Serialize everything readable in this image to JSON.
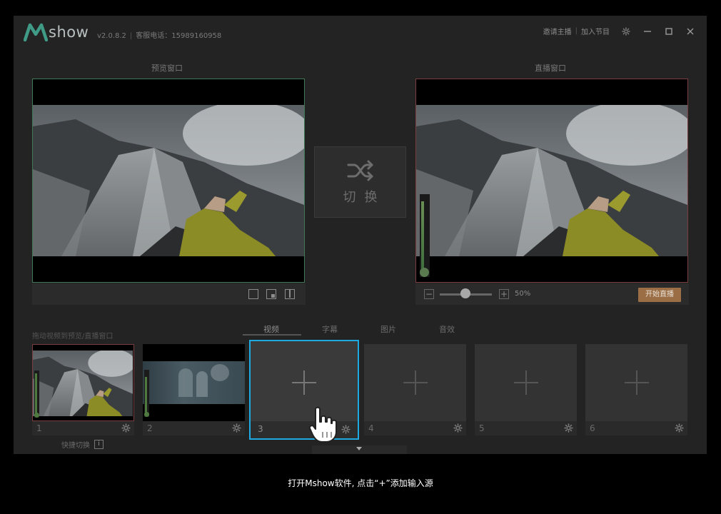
{
  "app": {
    "logo_text": "show",
    "version": "v2.0.8.2",
    "hotline": "客服电话：15989160958",
    "invite_host": "邀请主播",
    "join_program": "加入节目"
  },
  "panels": {
    "preview_title": "预览窗口",
    "live_title": "直播窗口",
    "switch_label": "切换",
    "volume_pct": "50%",
    "go_live": "开始直播"
  },
  "sources": {
    "drag_hint": "拖动视频到预览/直播窗口",
    "tabs": [
      "视频",
      "字幕",
      "图片",
      "音效"
    ],
    "active_tab": 0,
    "items": [
      {
        "num": "1",
        "content": "waterfall"
      },
      {
        "num": "2",
        "content": "concert"
      },
      {
        "num": "3",
        "content": "add"
      },
      {
        "num": "4",
        "content": "add"
      },
      {
        "num": "5",
        "content": "add"
      },
      {
        "num": "6",
        "content": "add"
      }
    ],
    "quick_switch": "快捷切换"
  },
  "caption": "打开Mshow软件, 点击“+”添加输入源",
  "colors": {
    "preview_border": "#3e7a58",
    "live_border": "#7a3e3e",
    "selected_source_border": "#1fa9e1",
    "go_live_bg": "#9b6e45"
  }
}
